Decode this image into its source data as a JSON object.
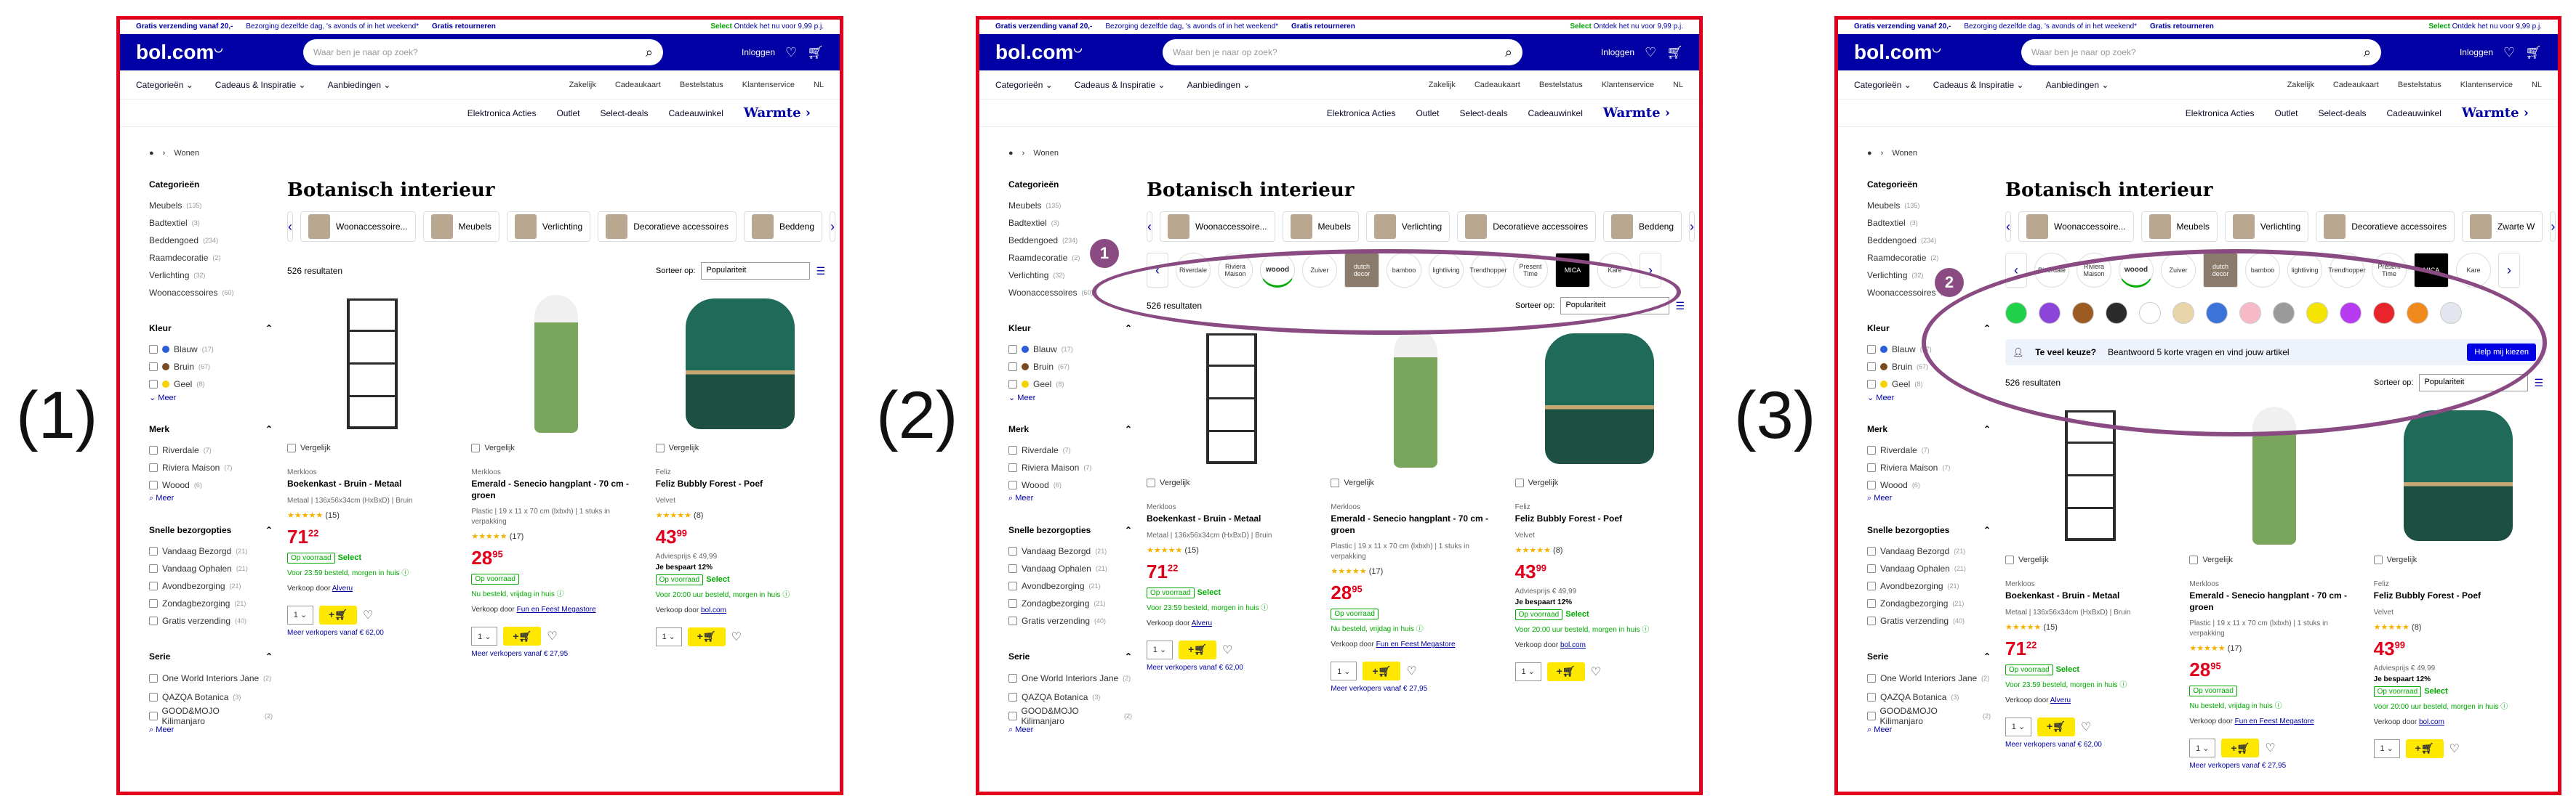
{
  "labels": [
    "(1)",
    "(2)",
    "(3)"
  ],
  "topbar": {
    "a": "Gratis verzending vanaf 20,-",
    "b": "Bezorging dezelfde dag, 's avonds of in het weekend*",
    "c": "Gratis retourneren",
    "sel_prefix": "Select",
    "sel_text": "Ontdek het nu voor 9,99 p.j."
  },
  "header": {
    "logo": "bol.com",
    "search_placeholder": "Waar ben je naar op zoek?",
    "login": "Inloggen"
  },
  "nav": {
    "left": [
      "Categorieën",
      "Cadeaus & Inspiratie",
      "Aanbiedingen"
    ],
    "right": [
      "Zakelijk",
      "Cadeaukaart",
      "Bestelstatus",
      "Klantenservice",
      "NL"
    ]
  },
  "subnav": {
    "items": [
      "Elektronica Acties",
      "Outlet",
      "Select-deals",
      "Cadeauwinkel"
    ],
    "warm": "Warmte"
  },
  "crumb": "Wonen",
  "side": {
    "cat_title": "Categorieën",
    "cats": [
      [
        "Meubels",
        "(135)"
      ],
      [
        "Badtextiel",
        "(3)"
      ],
      [
        "Beddengoed",
        "(234)"
      ],
      [
        "Raamdecoratie",
        "(2)"
      ],
      [
        "Verlichting",
        "(32)"
      ],
      [
        "Woonaccessoires",
        "(60)"
      ]
    ],
    "kleur_title": "Kleur",
    "kleur": [
      [
        "Blauw",
        "(17)",
        "#2b5fd9"
      ],
      [
        "Bruin",
        "(67)",
        "#7b4a1f"
      ],
      [
        "Geel",
        "(8)",
        "#f6d300"
      ]
    ],
    "meer": "Meer",
    "merk_title": "Merk",
    "merk": [
      [
        "Riverdale",
        "(7)"
      ],
      [
        "Riviera Maison",
        "(7)"
      ],
      [
        "Woood",
        "(6)"
      ]
    ],
    "snel_title": "Snelle bezorgopties",
    "snel": [
      [
        "Vandaag Bezorgd",
        "(21)"
      ],
      [
        "Vandaag Ophalen",
        "(21)"
      ],
      [
        "Avondbezorging",
        "(21)"
      ],
      [
        "Zondagbezorging",
        "(21)"
      ],
      [
        "Gratis verzending",
        "(40)"
      ]
    ],
    "serie_title": "Serie",
    "serie": [
      [
        "One World Interiors Jane",
        "(2)"
      ],
      [
        "QAZQA Botanica",
        "(3)"
      ],
      [
        "GOOD&MOJO Kilimanjaro",
        "(2)"
      ]
    ]
  },
  "main": {
    "title": "Botanisch interieur",
    "cats": [
      "Woonaccessoire...",
      "Meubels",
      "Verlichting",
      "Decoratieve accessoires",
      "Beddeng"
    ],
    "cats3": [
      "Woonaccessoire...",
      "Meubels",
      "Verlichting",
      "Decoratieve accessoires",
      "Zwarte W"
    ],
    "results": "526 resultaten",
    "sort_label": "Sorteer op:",
    "sort_value": "Populariteit",
    "brands": [
      "Riverdale",
      "Riviera Maison",
      "woood",
      "Zuiver",
      "dutch decor",
      "bamboo",
      "lightliving",
      "Trendhopper",
      "Present Time",
      "MICA",
      "Kare"
    ],
    "swatches": [
      "#22d14a",
      "#8b45d8",
      "#9b5b22",
      "#2b2b2b",
      "#ffffff",
      "#e8d4a8",
      "#3c73d8",
      "#f7b9c8",
      "#9a9a9a",
      "#f5e400",
      "#b53af0",
      "#e8252b",
      "#f08a1d",
      "#e3e6ee"
    ],
    "tvk_title": "Te veel keuze?",
    "tvk_text": "Beantwoord 5 korte vragen en vind jouw artikel",
    "tvk_btn": "Help mij kiezen",
    "compare": "Vergelijk",
    "products": [
      {
        "brand": "Merkloos",
        "title": "Boekenkast - Bruin - Metaal",
        "spec": "Metaal | 136x56x34cm (HxBxD) | Bruin",
        "stars": "★★★★★",
        "count": "(15)",
        "price": "71",
        "cents": "22",
        "old": "",
        "save": "",
        "badge": "Op voorraad",
        "select": "Select",
        "deliv": "Voor 23:59 besteld, morgen in huis",
        "seller_p": "Verkoop door",
        "seller": "Alveru",
        "more": "Meer verkopers vanaf € 62,00",
        "img": "shelf"
      },
      {
        "brand": "Merkloos",
        "title": "Emerald - Senecio hangplant - 70 cm - groen",
        "spec": "Plastic | 19 x 11 x 70 cm (lxbxh) | 1 stuks in verpakking",
        "stars": "★★★★★",
        "count": "(17)",
        "price": "28",
        "cents": "95",
        "old": "",
        "save": "",
        "badge": "Op voorraad",
        "select": "",
        "deliv": "Nu besteld, vrijdag in huis",
        "seller_p": "Verkoop door",
        "seller": "Fun en Feest Megastore",
        "more": "Meer verkopers vanaf € 27,95",
        "img": "plant"
      },
      {
        "brand": "Feliz",
        "title": "Feliz Bubbly Forest - Poef",
        "spec": "Velvet",
        "stars": "★★★★★",
        "count": "(8)",
        "price": "43",
        "cents": "99",
        "old": "Adviesprijs € 49,99",
        "save": "Je bespaart 12%",
        "badge": "Op voorraad",
        "select": "Select",
        "deliv": "Voor 20:00 uur besteld, morgen in huis",
        "seller_p": "Verkoop door",
        "seller": "bol.com",
        "more": "",
        "img": "pouf"
      }
    ]
  },
  "annot": {
    "n1": "1",
    "n2": "2"
  }
}
